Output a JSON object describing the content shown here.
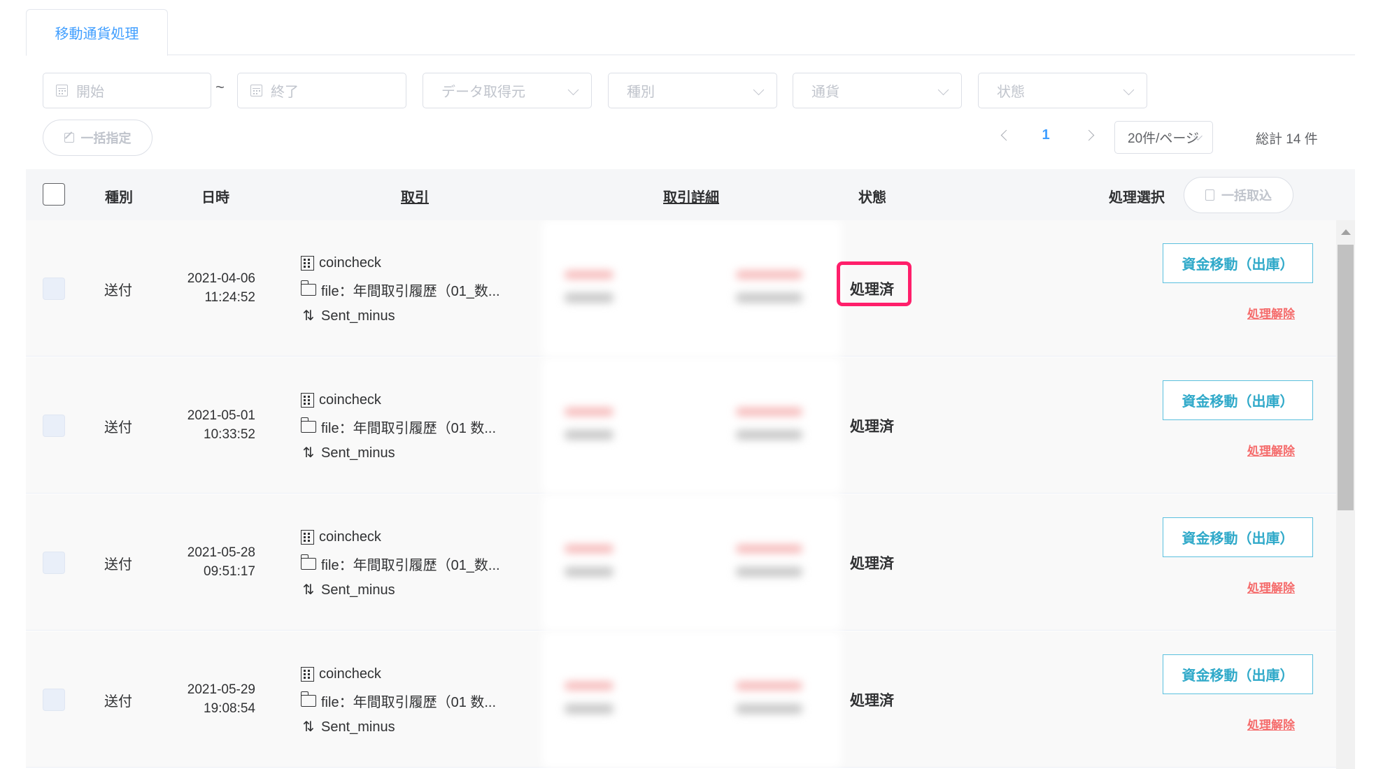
{
  "tabs": {
    "active": "移動通貨処理"
  },
  "filters": {
    "start_placeholder": "開始",
    "range_separator": "~",
    "end_placeholder": "終了",
    "source_placeholder": "データ取得元",
    "type_placeholder": "種別",
    "currency_placeholder": "通貨",
    "status_placeholder": "状態"
  },
  "bulk_assign_label": "一括指定",
  "pagination": {
    "current_page": "1",
    "page_size": "20件/ページ",
    "total": "総計 14 件"
  },
  "table": {
    "headers": {
      "type": "種別",
      "datetime": "日時",
      "deal": "取引",
      "deal_detail": "取引詳細",
      "status": "状態",
      "process_select": "処理選択"
    },
    "bulk_import_label": "一括取込",
    "rows": [
      {
        "type": "送付",
        "date": "2021-04-06",
        "time": "11:24:52",
        "exchange": "coincheck",
        "file": "file：年間取引履歴（01_数...",
        "kind": "Sent_minus",
        "status": "処理済",
        "action": "資金移動（出庫）",
        "unlink": "処理解除"
      },
      {
        "type": "送付",
        "date": "2021-05-01",
        "time": "10:33:52",
        "exchange": "coincheck",
        "file": "file：年間取引履歴（01 数...",
        "kind": "Sent_minus",
        "status": "処理済",
        "action": "資金移動（出庫）",
        "unlink": "処理解除"
      },
      {
        "type": "送付",
        "date": "2021-05-28",
        "time": "09:51:17",
        "exchange": "coincheck",
        "file": "file：年間取引履歴（01_数...",
        "kind": "Sent_minus",
        "status": "処理済",
        "action": "資金移動（出庫）",
        "unlink": "処理解除"
      },
      {
        "type": "送付",
        "date": "2021-05-29",
        "time": "19:08:54",
        "exchange": "coincheck",
        "file": "file：年間取引履歴（01 数...",
        "kind": "Sent_minus",
        "status": "処理済",
        "action": "資金移動（出庫）",
        "unlink": "処理解除"
      }
    ]
  },
  "colors": {
    "accent": "#409eff",
    "action_border": "#5bc0de",
    "danger": "#f56c6c",
    "highlight": "#ff1f6b"
  }
}
